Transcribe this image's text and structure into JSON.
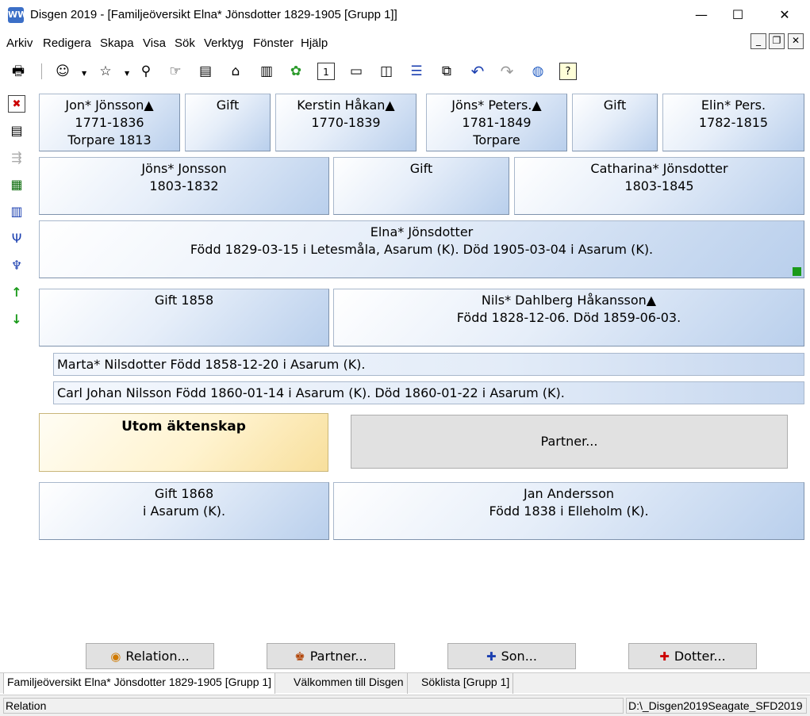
{
  "window": {
    "app_icon_text": "WW",
    "title": "Disgen 2019 - [Familjeöversikt Elna* Jönsdotter 1829-1905 [Grupp 1]]",
    "minimize": "—",
    "maximize": "☐",
    "close": "✕"
  },
  "menu": [
    "Arkiv",
    "Redigera",
    "Skapa",
    "Visa",
    "Sök",
    "Verktyg",
    "Fönster",
    "Hjälp"
  ],
  "mdi": {
    "minimize": "_",
    "restore": "❐",
    "close": "✕"
  },
  "toolbar_icons": {
    "print": "🖶",
    "person": "☺",
    "person_star": "☆",
    "search": "⚲",
    "hand": "☞",
    "book": "▤",
    "home": "⌂",
    "books": "▥",
    "map": "✿",
    "calendar": "1",
    "win1": "▭",
    "win2": "◫",
    "win3": "☰",
    "win4": "⧉",
    "undo": "↶",
    "redo": "↷",
    "globe": "◍",
    "help": "?"
  },
  "side_icons": {
    "delete": "✖",
    "document": "▤",
    "tree_dim": "⇶",
    "grid": "▦",
    "columns": "▥",
    "fork": "Ψ",
    "hierarchy": "♆",
    "up": "↑",
    "down": "↓"
  },
  "grandparents": [
    {
      "lines": [
        "Jon* Jönsson▲",
        "1771-1836",
        "Torpare  1813"
      ]
    },
    {
      "lines": [
        "Gift"
      ]
    },
    {
      "lines": [
        "Kerstin Håkan▲",
        "1770-1839"
      ]
    },
    {
      "lines": [
        "Jöns* Peters.▲",
        "1781-1849",
        "Torpare"
      ]
    },
    {
      "lines": [
        "Gift"
      ]
    },
    {
      "lines": [
        "Elin* Pers.",
        "1782-1815"
      ]
    }
  ],
  "parents": [
    {
      "lines": [
        "Jöns* Jonsson",
        "1803-1832"
      ]
    },
    {
      "lines": [
        "Gift"
      ]
    },
    {
      "lines": [
        "Catharina* Jönsdotter",
        "1803-1845"
      ]
    }
  ],
  "main_person": {
    "lines": [
      "Elna* Jönsdotter",
      "Född 1829-03-15 i Letesmåla, Asarum (K). Död 1905-03-04 i Asarum (K)."
    ]
  },
  "marriage1": {
    "label": "Gift 1858",
    "partner_lines": [
      "Nils* Dahlberg Håkansson▲",
      "Född 1828-12-06. Död 1859-06-03."
    ]
  },
  "children": [
    "Marta* Nilsdotter Född 1858-12-20 i Asarum (K).",
    "Carl Johan Nilsson Född 1860-01-14 i Asarum (K). Död 1860-01-22 i Asarum (K)."
  ],
  "outside_marriage": {
    "label": "Utom äktenskap",
    "partner_button": "Partner..."
  },
  "marriage2": {
    "lines": [
      "Gift 1868",
      "i Asarum (K)."
    ],
    "partner_lines": [
      "Jan Andersson",
      "Född 1838 i Elleholm (K)."
    ]
  },
  "buttons": {
    "relation": {
      "icon": "◉",
      "label": "Relation..."
    },
    "partner": {
      "icon": "♚",
      "label": "Partner..."
    },
    "son": {
      "icon": "✚",
      "label": "Son..."
    },
    "dotter": {
      "icon": "✚",
      "label": "Dotter..."
    }
  },
  "tabs": [
    "Familjeöversikt Elna* Jönsdotter 1829-1905 [Grupp 1]",
    "Välkommen till Disgen",
    "Söklista [Grupp 1]"
  ],
  "status": {
    "left": "Relation",
    "right": "D:\\_Disgen2019Seagate_SFD2019"
  },
  "colors": {
    "box_blue": "#b9cfec",
    "yellow": "#f8df9c",
    "green_mark": "#1a9a1a"
  }
}
